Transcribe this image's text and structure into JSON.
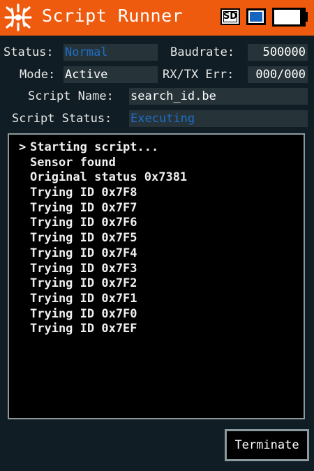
{
  "header": {
    "title": "Script Runner",
    "sd_label": "SD",
    "battery_level": 0.88
  },
  "status": {
    "status_label": "Status:",
    "status_value": "Normal",
    "baudrate_label": "Baudrate:",
    "baudrate_value": "500000",
    "mode_label": "Mode:",
    "mode_value": "Active",
    "err_label": "RX/TX Err:",
    "err_value": "000/000",
    "script_name_label": "Script Name:",
    "script_name_value": "search_id.be",
    "script_status_label": "Script Status:",
    "script_status_value": "Executing"
  },
  "console": {
    "prompt_symbol": ">",
    "lines": [
      "Starting script...",
      "Sensor found",
      "Original status 0x7381",
      "Trying ID 0x7F8",
      "Trying ID 0x7F7",
      "Trying ID 0x7F6",
      "Trying ID 0x7F5",
      "Trying ID 0x7F4",
      "Trying ID 0x7F3",
      "Trying ID 0x7F2",
      "Trying ID 0x7F1",
      "Trying ID 0x7F0",
      "Trying ID 0x7EF"
    ]
  },
  "actions": {
    "terminate_label": "Terminate"
  },
  "colors": {
    "header_bg": "#ef5b0e",
    "page_bg": "#101d24",
    "field_bg": "#263339",
    "accent_blue": "#1e6ec8"
  }
}
